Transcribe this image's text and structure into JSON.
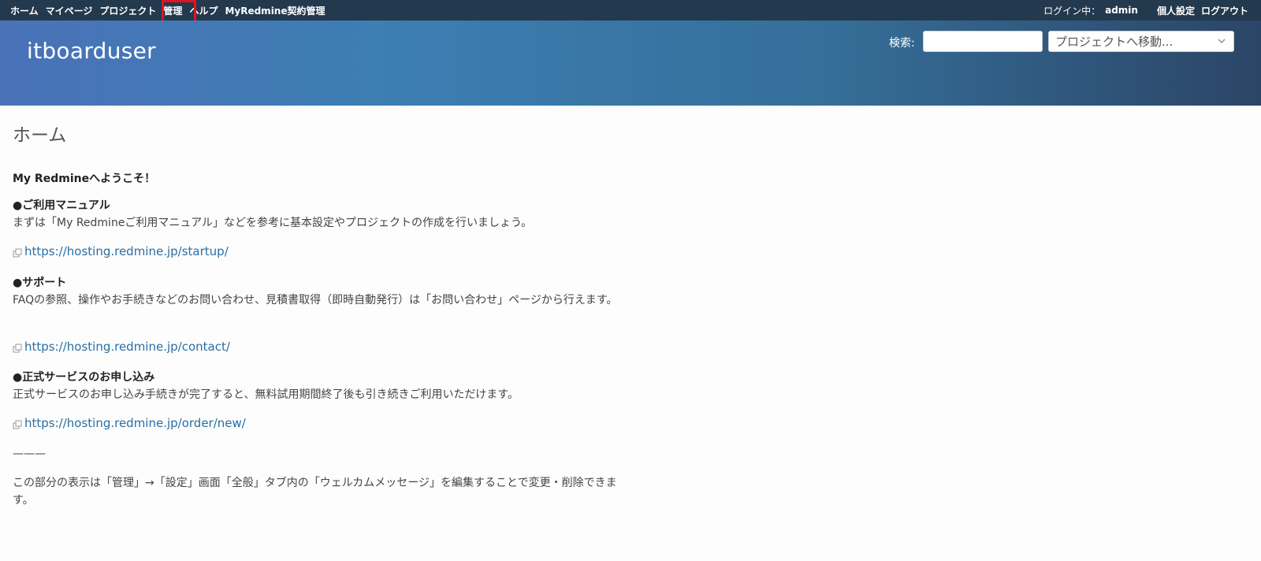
{
  "topbar": {
    "menu": [
      {
        "label": "ホーム"
      },
      {
        "label": "マイページ"
      },
      {
        "label": "プロジェクト"
      },
      {
        "label": "管理"
      },
      {
        "label": "ヘルプ"
      },
      {
        "label": "MyRedmine契約管理"
      }
    ],
    "login_label": "ログイン中：",
    "login_user": "admin",
    "account_label": "個人設定",
    "logout_label": "ログアウト"
  },
  "header": {
    "site_title": "itboarduser",
    "search_label": "検索:",
    "search_value": "",
    "project_jump_label": "プロジェクトへ移動..."
  },
  "main": {
    "page_title": "ホーム",
    "welcome": "My Redmineへようこそ！",
    "sections": [
      {
        "title": "●ご利用マニュアル",
        "text": "まずは「My Redmineご利用マニュアル」などを参考に基本設定やプロジェクトの作成を行いましょう。",
        "link": "https://hosting.redmine.jp/startup/"
      },
      {
        "title": "●サポート",
        "text": "FAQの参照、操作やお手続きなどのお問い合わせ、見積書取得（即時自動発行）は「お問い合わせ」ページから行えます。",
        "link": "https://hosting.redmine.jp/contact/"
      },
      {
        "title": "●正式サービスのお申し込み",
        "text": "正式サービスのお申し込み手続きが完了すると、無料試用期間終了後も引き続きご利用いただけます。",
        "link": "https://hosting.redmine.jp/order/new/"
      }
    ],
    "divider": "———",
    "footer_note": "この部分の表示は「管理」→「設定」画面「全般」タブ内の「ウェルカムメッセージ」を編集することで変更・削除できます。"
  }
}
